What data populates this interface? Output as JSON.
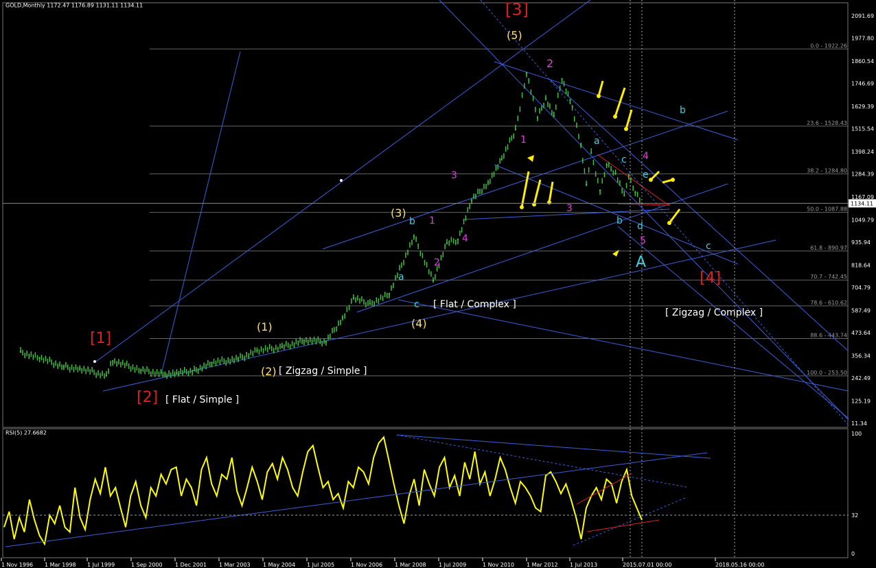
{
  "header": {
    "main_title": "GOLD,Monthly  1172.47 1176.89 1131.11 1134.11",
    "rsi_title": "RSI(5) 27.6682"
  },
  "colors": {
    "background": "#000000",
    "price_bars": "#3cc43c",
    "trendline": "#3a5fe0",
    "fib_level": "#666666",
    "rsi_line": "#ffff00",
    "red_label": "#e01e1e",
    "yellow_label": "#ffe066",
    "cyan_label": "#3fd0e0",
    "magenta_label": "#e040e0"
  },
  "chart_data": [
    {
      "type": "line",
      "title": "GOLD,Monthly",
      "ylim": [
        11.34,
        2091.69
      ],
      "x_tick_labels": [
        "1 Nov 1996",
        "1 Mar 1998",
        "1 Jul 1999",
        "1 Sep 2000",
        "1 Dec 2001",
        "1 Mar 2003",
        "1 May 2004",
        "1 Jul 2005",
        "1 Nov 2006",
        "1 Mar 2008",
        "1 Jul 2009",
        "1 Nov 2010",
        "1 Mar 2012",
        "1 Jul 2013",
        "2015.07.01 00:00",
        "2018.05.16 00:00"
      ],
      "y_tick_labels": [
        "2091.69",
        "1977.80",
        "1860.54",
        "1746.69",
        "1629.39",
        "1515.54",
        "1398.24",
        "1284.39",
        "1167.09",
        "1049.79",
        "935.94",
        "818.64",
        "704.79",
        "587.49",
        "473.64",
        "356.34",
        "242.49",
        "125.19",
        "11.34"
      ],
      "current_price_label": "1134.11",
      "series": [
        {
          "x": [
            "1996-11",
            "1997-06",
            "1998-03",
            "1998-09",
            "1999-07",
            "1999-09",
            "2000-06",
            "2001-02",
            "2001-06",
            "2001-12",
            "2002-06",
            "2003-03",
            "2003-09",
            "2004-05",
            "2004-12",
            "2005-07",
            "2006-01",
            "2006-05",
            "2006-11",
            "2007-06",
            "2008-03",
            "2008-10",
            "2009-03",
            "2009-07",
            "2009-12",
            "2010-06",
            "2010-11",
            "2011-04",
            "2011-08",
            "2011-12",
            "2012-03",
            "2012-06",
            "2012-09",
            "2012-12",
            "2013-04",
            "2013-06",
            "2013-08",
            "2013-12",
            "2014-03",
            "2014-07",
            "2014-11",
            "2015-01",
            "2015-04",
            "2015-07"
          ],
          "values": [
            375,
            345,
            300,
            290,
            255,
            330,
            282,
            262,
            268,
            280,
            320,
            340,
            382,
            400,
            435,
            427,
            550,
            650,
            620,
            672,
            965,
            740,
            930,
            950,
            1150,
            1240,
            1360,
            1510,
            1800,
            1570,
            1670,
            1580,
            1770,
            1660,
            1430,
            1230,
            1390,
            1200,
            1330,
            1290,
            1175,
            1280,
            1190,
            1134
          ]
        }
      ],
      "fibonacci": [
        {
          "label": "0.0 - 1922.26",
          "value": 1922.26
        },
        {
          "label": "23.6 - 1528.43",
          "value": 1528.43
        },
        {
          "label": "38.2 - 1284.80",
          "value": 1284.8
        },
        {
          "label": "50.0 - 1087.88",
          "value": 1087.88
        },
        {
          "label": "61.8 - 890.97",
          "value": 890.97
        },
        {
          "label": "70.7 - 742.45",
          "value": 742.45
        },
        {
          "label": "78.6 - 610.62",
          "value": 610.62
        },
        {
          "label": "88.6 - 443.74",
          "value": 443.74
        },
        {
          "label": "100.0 - 253.50",
          "value": 253.5
        }
      ],
      "annotations": [
        {
          "text": "[3]",
          "color": "red"
        },
        {
          "text": "[1]",
          "color": "red"
        },
        {
          "text": "[2]",
          "color": "red"
        },
        {
          "text": "[4]",
          "color": "red"
        },
        {
          "text": "(5)",
          "color": "yellow"
        },
        {
          "text": "(3)",
          "color": "yellow"
        },
        {
          "text": "(1)",
          "color": "yellow"
        },
        {
          "text": "(2)",
          "color": "yellow"
        },
        {
          "text": "(4)",
          "color": "yellow"
        },
        {
          "text": "[ Zigzag / Simple ]",
          "color": "white"
        },
        {
          "text": "[ Flat / Simple ]",
          "color": "white"
        },
        {
          "text": "[ Flat / Complex ]",
          "color": "white"
        },
        {
          "text": "[ Zigzag / Complex ]",
          "color": "white"
        },
        {
          "text": "2",
          "color": "magenta"
        },
        {
          "text": "1",
          "color": "magenta"
        },
        {
          "text": "3",
          "color": "magenta"
        },
        {
          "text": "4",
          "color": "magenta"
        },
        {
          "text": "5",
          "color": "magenta"
        },
        {
          "text": "a",
          "color": "cyan"
        },
        {
          "text": "b",
          "color": "cyan"
        },
        {
          "text": "c",
          "color": "cyan"
        },
        {
          "text": "d",
          "color": "cyan"
        },
        {
          "text": "e",
          "color": "cyan"
        },
        {
          "text": "A",
          "color": "cyan"
        }
      ]
    },
    {
      "type": "line",
      "title": "RSI(5) 27.6682",
      "ylim": [
        0,
        100
      ],
      "y_tick_labels": [
        "100",
        "32",
        "0"
      ],
      "series": [
        {
          "name": "RSI(5)",
          "values": [
            22,
            35,
            12,
            30,
            18,
            45,
            28,
            15,
            8,
            32,
            25,
            40,
            22,
            18,
            55,
            30,
            20,
            45,
            62,
            50,
            72,
            48,
            55,
            38,
            22,
            48,
            60,
            40,
            30,
            55,
            48,
            66,
            58,
            70,
            72,
            48,
            62,
            55,
            40,
            70,
            80,
            58,
            48,
            66,
            62,
            80,
            52,
            40,
            55,
            72,
            60,
            45,
            68,
            75,
            62,
            80,
            70,
            55,
            48,
            68,
            85,
            90,
            72,
            55,
            60,
            45,
            50,
            38,
            60,
            55,
            72,
            68,
            58,
            80,
            92,
            97,
            78,
            58,
            40,
            25,
            48,
            62,
            40,
            70,
            58,
            48,
            72,
            80,
            55,
            65,
            48,
            76,
            62,
            85,
            58,
            68,
            48,
            62,
            80,
            70,
            55,
            42,
            60,
            55,
            48,
            38,
            35,
            65,
            68,
            60,
            50,
            58,
            45,
            30,
            12,
            38,
            48,
            55,
            45,
            62,
            58,
            42,
            60,
            70,
            48,
            38,
            28
          ]
        }
      ]
    }
  ]
}
